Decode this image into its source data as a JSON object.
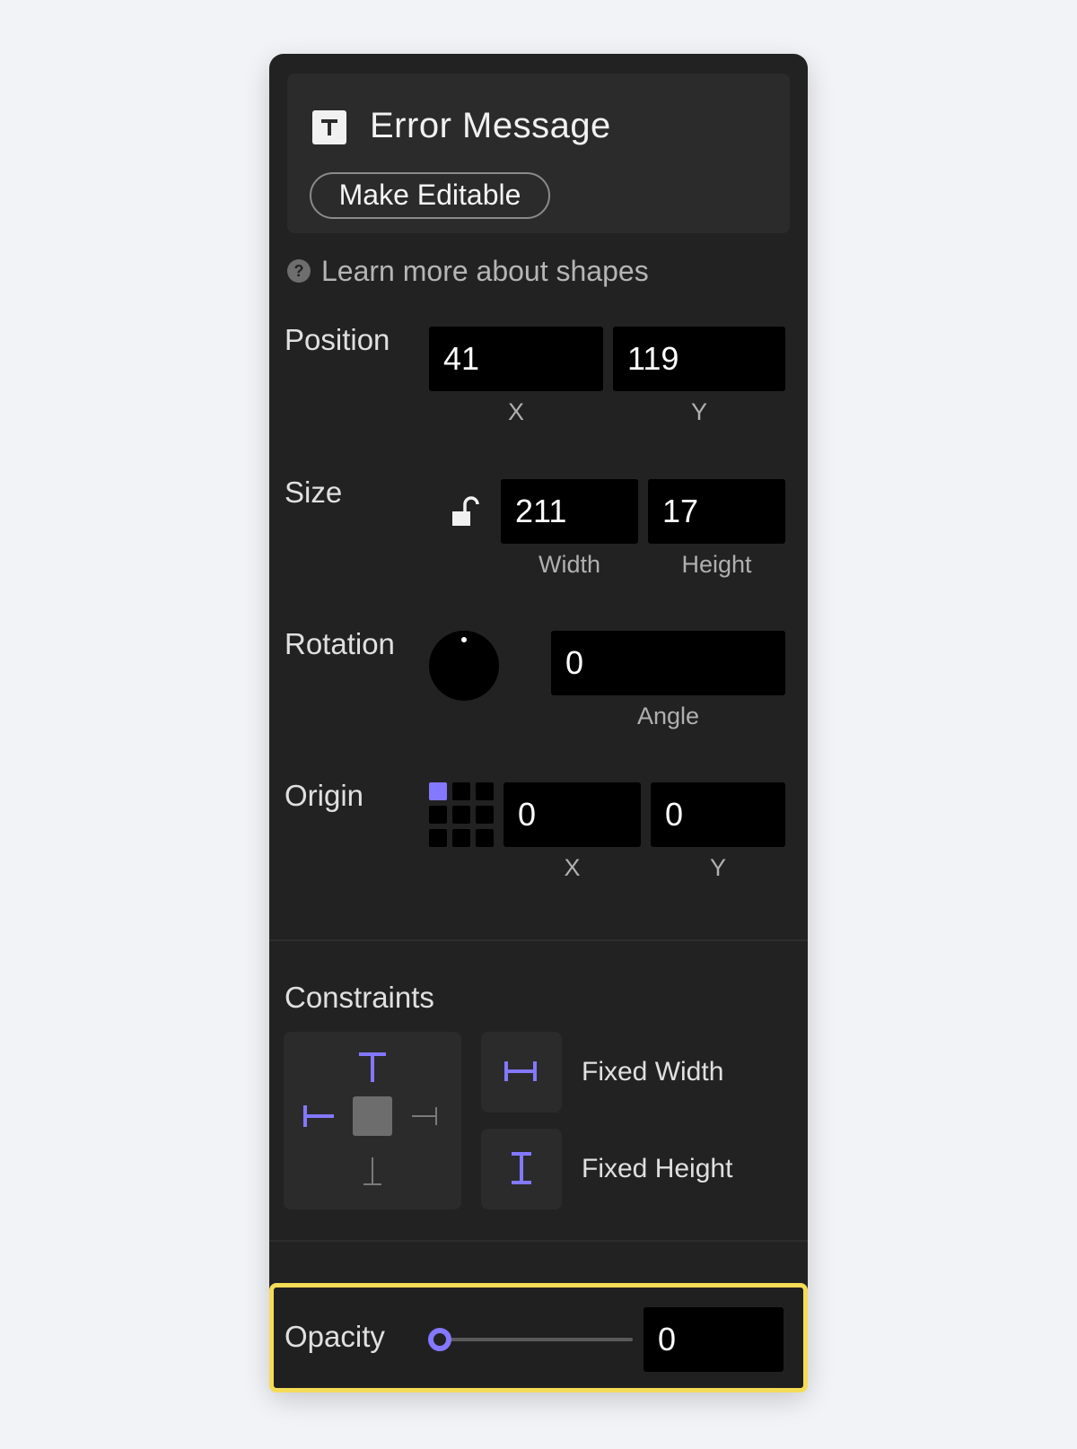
{
  "header": {
    "title": "Error Message",
    "make_editable_label": "Make Editable"
  },
  "learn_link": "Learn more about shapes",
  "position": {
    "label": "Position",
    "x_value": "41",
    "y_value": "119",
    "x_label": "X",
    "y_label": "Y"
  },
  "size": {
    "label": "Size",
    "width_value": "211",
    "height_value": "17",
    "width_label": "Width",
    "height_label": "Height"
  },
  "rotation": {
    "label": "Rotation",
    "angle_value": "0",
    "angle_label": "Angle"
  },
  "origin": {
    "label": "Origin",
    "x_value": "0",
    "y_value": "0",
    "x_label": "X",
    "y_label": "Y"
  },
  "constraints": {
    "label": "Constraints",
    "fixed_width": "Fixed Width",
    "fixed_height": "Fixed Height"
  },
  "opacity": {
    "label": "Opacity",
    "value": "0"
  },
  "colors": {
    "accent": "#8378ff",
    "highlight": "#f5dc57",
    "panel": "#222222"
  }
}
